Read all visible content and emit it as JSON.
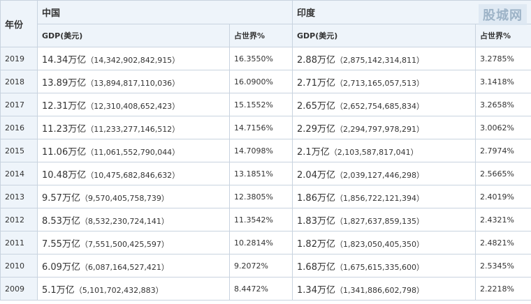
{
  "header": {
    "year": "年份",
    "china": "中国",
    "india": "印度",
    "gdp": "GDP(美元)",
    "share": "占世界%"
  },
  "watermark": "股城网",
  "rows": [
    {
      "year": "2019",
      "cn_yi": "14.34万亿",
      "cn_full": "14,342,902,842,915",
      "cn_share": "16.3550%",
      "in_yi": "2.88万亿",
      "in_full": "2,875,142,314,811",
      "in_share": "3.2785%"
    },
    {
      "year": "2018",
      "cn_yi": "13.89万亿",
      "cn_full": "13,894,817,110,036",
      "cn_share": "16.0900%",
      "in_yi": "2.71万亿",
      "in_full": "2,713,165,057,513",
      "in_share": "3.1418%"
    },
    {
      "year": "2017",
      "cn_yi": "12.31万亿",
      "cn_full": "12,310,408,652,423",
      "cn_share": "15.1552%",
      "in_yi": "2.65万亿",
      "in_full": "2,652,754,685,834",
      "in_share": "3.2658%"
    },
    {
      "year": "2016",
      "cn_yi": "11.23万亿",
      "cn_full": "11,233,277,146,512",
      "cn_share": "14.7156%",
      "in_yi": "2.29万亿",
      "in_full": "2,294,797,978,291",
      "in_share": "3.0062%"
    },
    {
      "year": "2015",
      "cn_yi": "11.06万亿",
      "cn_full": "11,061,552,790,044",
      "cn_share": "14.7098%",
      "in_yi": "2.1万亿",
      "in_full": "2,103,587,817,041",
      "in_share": "2.7974%"
    },
    {
      "year": "2014",
      "cn_yi": "10.48万亿",
      "cn_full": "10,475,682,846,632",
      "cn_share": "13.1851%",
      "in_yi": "2.04万亿",
      "in_full": "2,039,127,446,298",
      "in_share": "2.5665%"
    },
    {
      "year": "2013",
      "cn_yi": "9.57万亿",
      "cn_full": "9,570,405,758,739",
      "cn_share": "12.3805%",
      "in_yi": "1.86万亿",
      "in_full": "1,856,722,121,394",
      "in_share": "2.4019%"
    },
    {
      "year": "2012",
      "cn_yi": "8.53万亿",
      "cn_full": "8,532,230,724,141",
      "cn_share": "11.3542%",
      "in_yi": "1.83万亿",
      "in_full": "1,827,637,859,135",
      "in_share": "2.4321%"
    },
    {
      "year": "2011",
      "cn_yi": "7.55万亿",
      "cn_full": "7,551,500,425,597",
      "cn_share": "10.2814%",
      "in_yi": "1.82万亿",
      "in_full": "1,823,050,405,350",
      "in_share": "2.4821%"
    },
    {
      "year": "2010",
      "cn_yi": "6.09万亿",
      "cn_full": "6,087,164,527,421",
      "cn_share": "9.2072%",
      "in_yi": "1.68万亿",
      "in_full": "1,675,615,335,600",
      "in_share": "2.5345%"
    },
    {
      "year": "2009",
      "cn_yi": "5.1万亿",
      "cn_full": "5,101,702,432,883",
      "cn_share": "8.4472%",
      "in_yi": "1.34万亿",
      "in_full": "1,341,886,602,798",
      "in_share": "2.2218%"
    }
  ]
}
